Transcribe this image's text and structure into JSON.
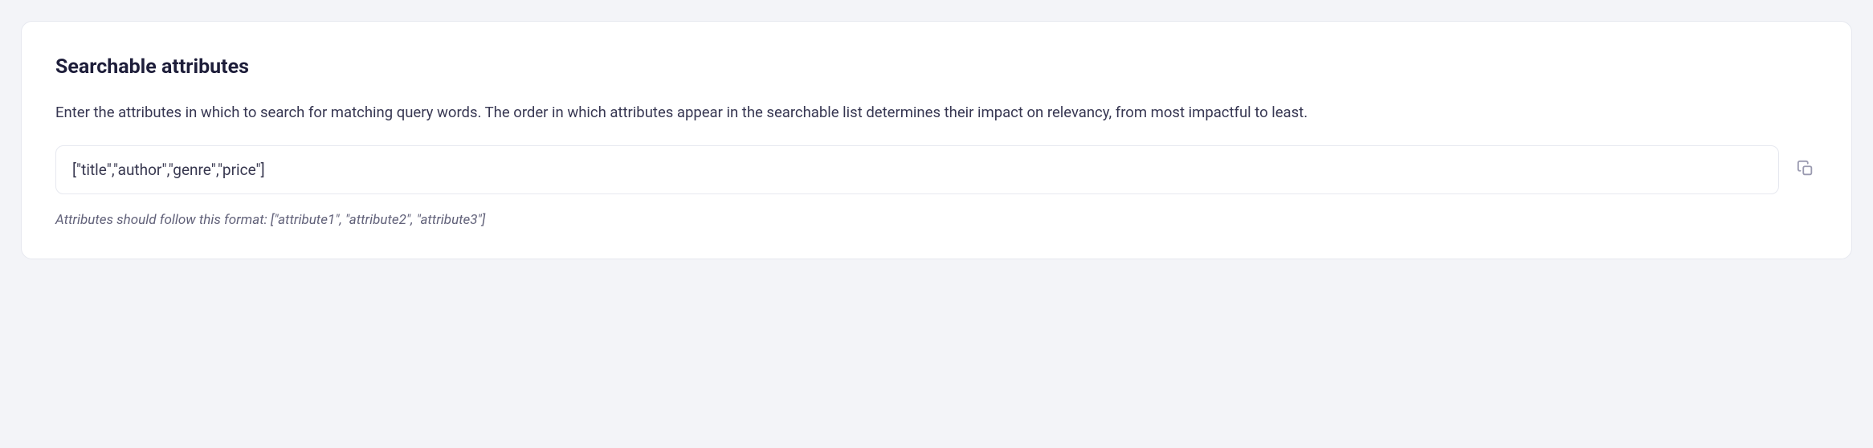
{
  "section": {
    "title": "Searchable attributes",
    "description": "Enter the attributes in which to search for matching query words. The order in which attributes appear in the searchable list determines their impact on relevancy, from most impactful to least.",
    "input_value": "[\"title\",\"author\",\"genre\",\"price\"]",
    "hint": "Attributes should follow this format: [\"attribute1\", \"attribute2\", \"attribute3\"]"
  }
}
